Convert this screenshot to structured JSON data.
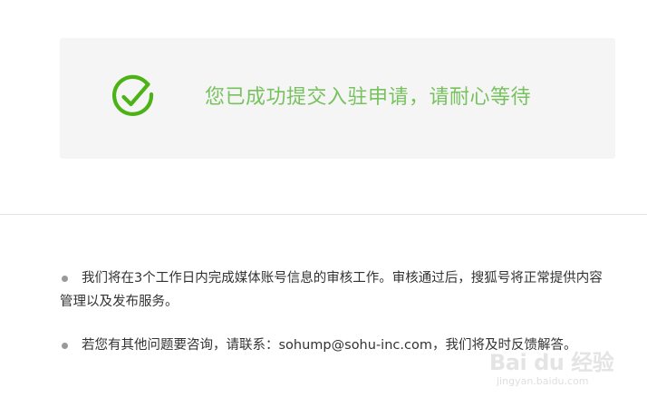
{
  "success": {
    "message": "您已成功提交入驻申请，请耐心等待",
    "icon": "check-circle-icon",
    "accent_color": "#4cb316",
    "text_color": "#77c25e"
  },
  "notes": [
    "我们将在3个工作日内完成媒体账号信息的审核工作。审核通过后，搜狐号将正常提供内容管理以及发布服务。",
    "若您有其他问题要咨询，请联系：sohump@sohu-inc.com，我们将及时反馈解答。"
  ],
  "watermark": {
    "logo": "Bai du 经验",
    "url": "jingyan.baidu.com"
  }
}
